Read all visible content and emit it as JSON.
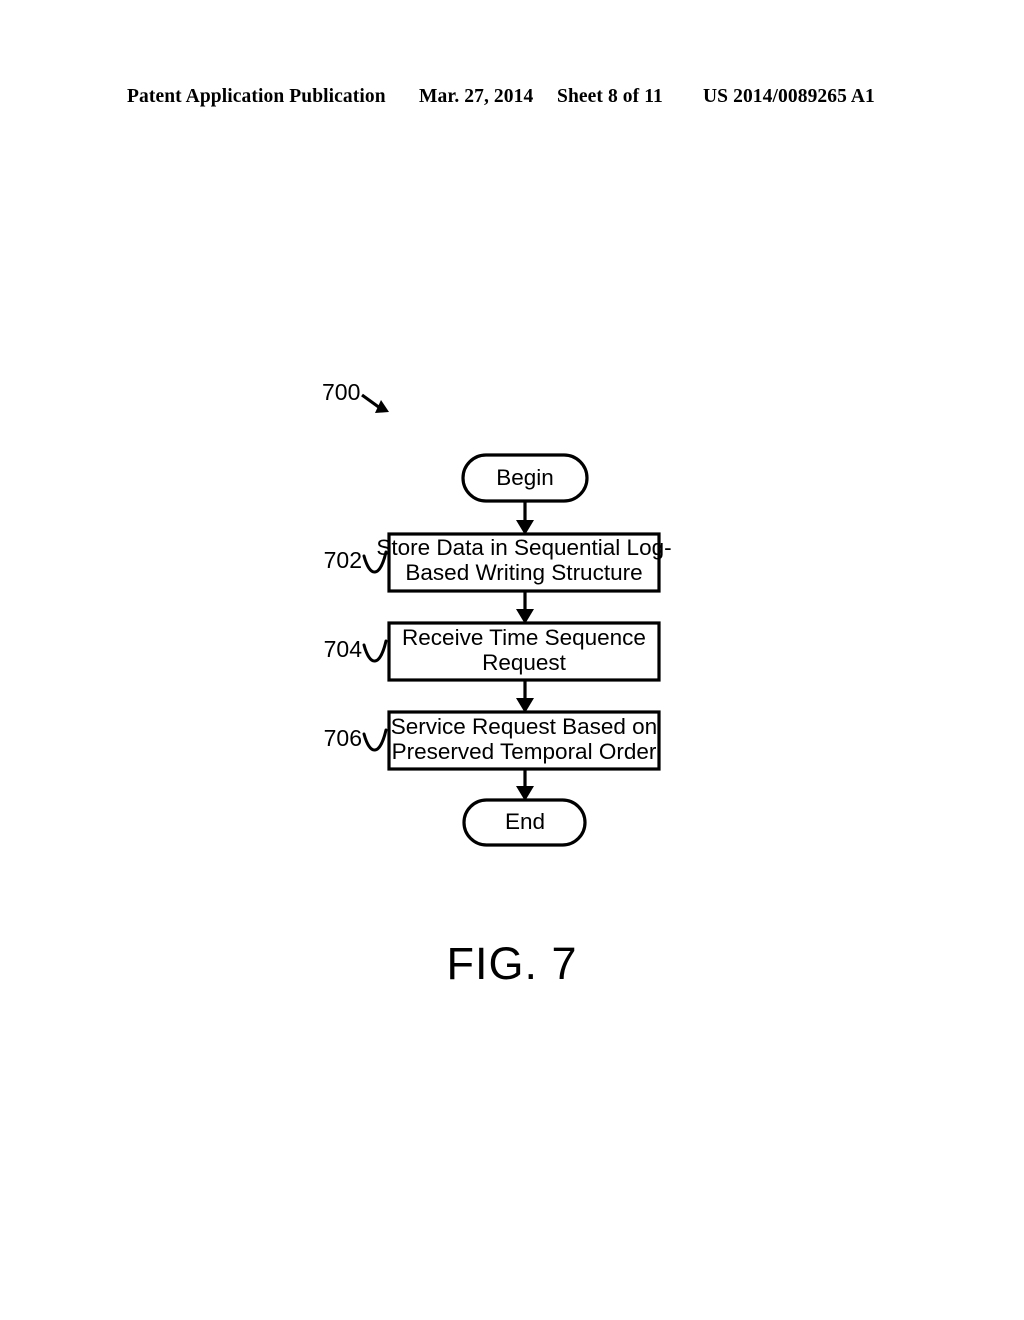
{
  "header": {
    "publication": "Patent Application Publication",
    "date": "Mar. 27, 2014",
    "sheet": "Sheet 8 of 11",
    "document_number": "US 2014/0089265 A1"
  },
  "figure": {
    "caption": "FIG. 7",
    "diagram_ref": "700",
    "nodes": {
      "begin": {
        "ref": "",
        "label": "Begin",
        "shape": "stadium"
      },
      "step_702": {
        "ref": "702",
        "label_line1": "Store Data in Sequential Log-",
        "label_line2": "Based Writing Structure",
        "shape": "rect"
      },
      "step_704": {
        "ref": "704",
        "label_line1": "Receive Time Sequence",
        "label_line2": "Request",
        "shape": "rect"
      },
      "step_706": {
        "ref": "706",
        "label_line1": "Service Request Based on",
        "label_line2": "Preserved Temporal Order",
        "shape": "rect"
      },
      "end": {
        "ref": "",
        "label": "End",
        "shape": "stadium"
      }
    }
  },
  "colors": {
    "ink": "#000000",
    "page": "#ffffff"
  }
}
